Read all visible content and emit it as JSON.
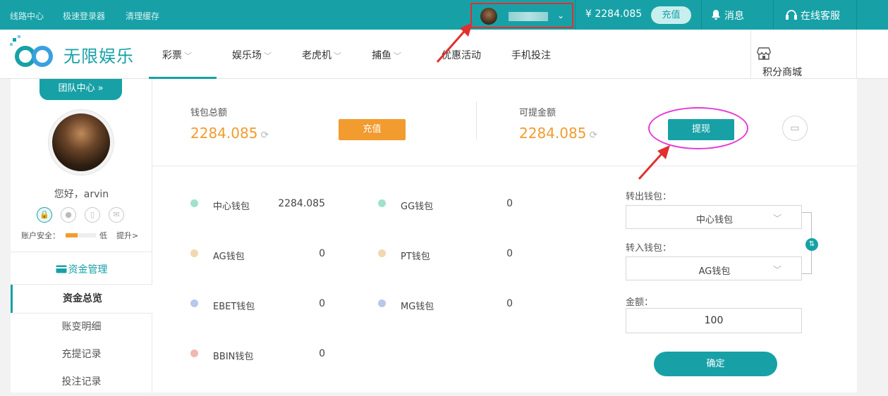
{
  "topbar": {
    "links": [
      "线路中心",
      "极速登录器",
      "清理缓存"
    ],
    "user_dropdown_caret": "⌄",
    "balance": "¥ 2284.085",
    "recharge_pill": "充值",
    "messages": "消息",
    "service": "在线客服"
  },
  "logo": {
    "text": "无限娱乐"
  },
  "nav": {
    "items": [
      "彩票",
      "娱乐场",
      "老虎机",
      "捕鱼",
      "优惠活动",
      "手机投注"
    ],
    "shop": "积分商城"
  },
  "sidebar": {
    "team_center": "团队中心 »",
    "greeting": "您好，arvin",
    "security_label": "账户安全：",
    "security_level_text": "低",
    "security_level_fraction": 0.4,
    "upgrade": "提升>",
    "section_title": "资金管理",
    "menu": [
      "资金总览",
      "账变明细",
      "充提记录",
      "投注记录"
    ]
  },
  "summary": {
    "total_label": "钱包总额",
    "total_amount": "2284.085",
    "recharge_button": "充值",
    "withdrawable_label": "可提金额",
    "withdrawable_amount": "2284.085",
    "withdraw_button": "提现"
  },
  "wallets": [
    {
      "name": "中心钱包",
      "value": "2284.085",
      "color": "#9ee3c8"
    },
    {
      "name": "GG钱包",
      "value": "0",
      "color": "#9ee3c8"
    },
    {
      "name": "AG钱包",
      "value": "0",
      "color": "#f0d8b0"
    },
    {
      "name": "PT钱包",
      "value": "0",
      "color": "#f0d8b0"
    },
    {
      "name": "EBET钱包",
      "value": "0",
      "color": "#b8c8ec"
    },
    {
      "name": "MG钱包",
      "value": "0",
      "color": "#b8c8ec"
    },
    {
      "name": "BBIN钱包",
      "value": "0",
      "color": "#f0b8b0"
    }
  ],
  "transfer": {
    "out_label": "转出钱包：",
    "out_value": "中心钱包",
    "in_label": "转入钱包：",
    "in_value": "AG钱包",
    "amount_label": "金额：",
    "amount_value": "100",
    "confirm": "确定"
  },
  "colors": {
    "accent": "#17a1a7",
    "orange": "#f29b2e",
    "annotation_red": "#e03030",
    "annotation_magenta": "#e43bd8"
  }
}
